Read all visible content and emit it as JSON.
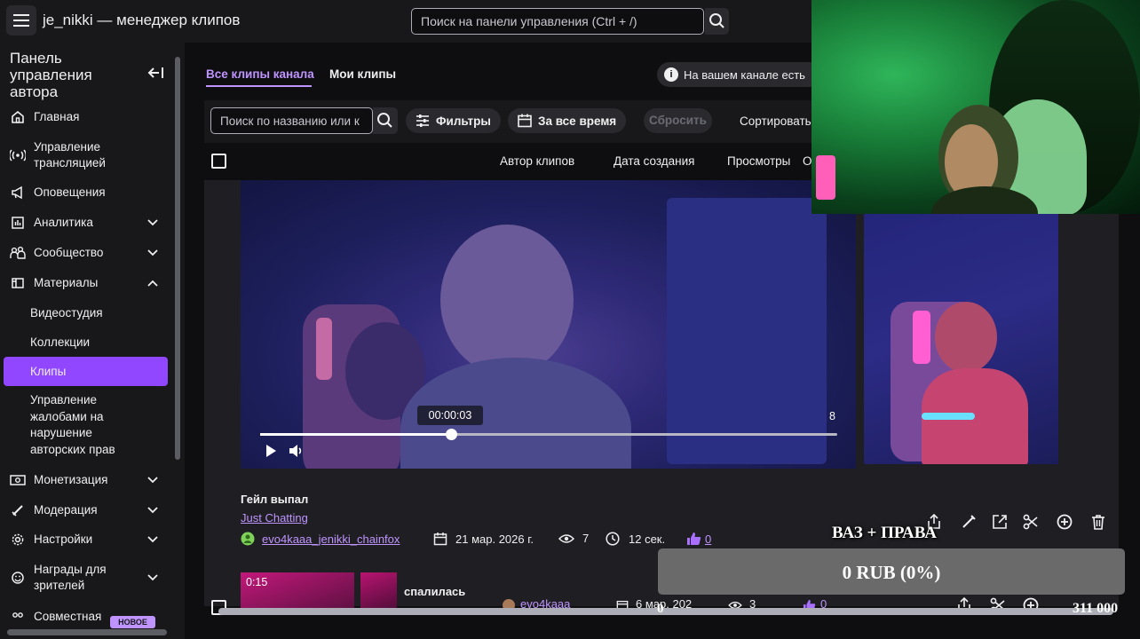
{
  "app": {
    "title": "je_nikki — менеджер клипов"
  },
  "top_search": {
    "placeholder": "Поиск на панели управления (Ctrl + /)"
  },
  "sidebar": {
    "title": "Панель управления автора",
    "items": [
      {
        "label": "Главная",
        "icon": "home-icon"
      },
      {
        "label": "Управление трансляцией",
        "icon": "broadcast-icon"
      },
      {
        "label": "Оповещения",
        "icon": "megaphone-icon"
      },
      {
        "label": "Аналитика",
        "icon": "chart-icon"
      },
      {
        "label": "Сообщество",
        "icon": "people-icon"
      },
      {
        "label": "Материалы",
        "icon": "content-icon"
      },
      {
        "label": "Видеостудия"
      },
      {
        "label": "Коллекции"
      },
      {
        "label": "Клипы"
      },
      {
        "label": "Управление жалобами на нарушение авторских прав"
      },
      {
        "label": "Монетизация",
        "icon": "money-icon"
      },
      {
        "label": "Модерация",
        "icon": "sword-icon"
      },
      {
        "label": "Настройки",
        "icon": "gear-icon"
      },
      {
        "label": "Награды для зрителей",
        "icon": "smile-icon"
      },
      {
        "label": "Совместная",
        "icon": "collab-icon"
      }
    ],
    "badge": "НОВОЕ"
  },
  "tabs": [
    {
      "label": "Все клипы канала"
    },
    {
      "label": "Мои клипы"
    }
  ],
  "info_banner": {
    "text": "На вашем канале есть"
  },
  "toolbar": {
    "search_placeholder": "Поиск по названию или к",
    "filters": "Фильтры",
    "period": "За все время",
    "reset": "Сбросить",
    "sort": "Сортировать"
  },
  "table_headers": {
    "author": "Автор клипов",
    "created": "Дата создания",
    "views": "Просмотры",
    "trunc": "О"
  },
  "player": {
    "current_time": "00:00:03",
    "end_label": "8",
    "progress": 0.33
  },
  "clips": [
    {
      "title": "Гейл выпал",
      "category": "Just Chatting",
      "author": "evo4kaaa_jenikki_chainfox",
      "date": "21 мар. 2026 г.",
      "views": "7",
      "duration": "12 сек.",
      "likes": "0"
    },
    {
      "title": "спалилась",
      "thumb_duration": "0:15",
      "author": "evo4kaaa",
      "date": "6 мар. 202",
      "views": "3",
      "likes": "0"
    }
  ],
  "overlay": {
    "label": "ВАЗ + ПРАВА",
    "progress_text": "0 RUB (0%)",
    "min": "0",
    "max": "311 000"
  },
  "colors": {
    "accent": "#9147ff",
    "link": "#bf94ff",
    "bg": "#0e0e10",
    "panel": "#18181b"
  }
}
